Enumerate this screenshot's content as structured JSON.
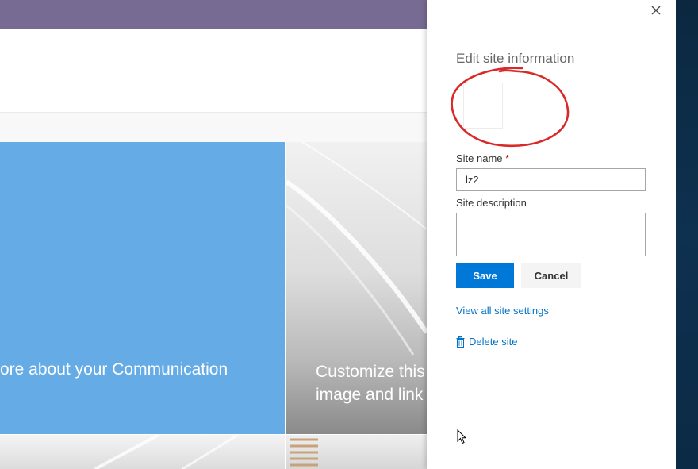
{
  "background": {
    "tile_blue_text": "ore about your Communication",
    "tile_photo_text_line1": "Customize this",
    "tile_photo_text_line2": "image and link",
    "suite_bar_color": "#786b93",
    "tile_blue_color": "#65abe6"
  },
  "panel": {
    "title": "Edit site information",
    "close_icon": "close-icon",
    "site_name_label": "Site name",
    "required_marker": "*",
    "site_name_value": "lz2",
    "site_description_label": "Site description",
    "site_description_value": "",
    "save_label": "Save",
    "cancel_label": "Cancel",
    "view_settings_link": "View all site settings",
    "delete_site_link": "Delete site",
    "delete_icon": "trash-icon",
    "accent_color": "#0078d7",
    "link_color": "#0073c6"
  },
  "annotation": {
    "shape": "hand-drawn-circle",
    "color": "#d92a2a"
  }
}
